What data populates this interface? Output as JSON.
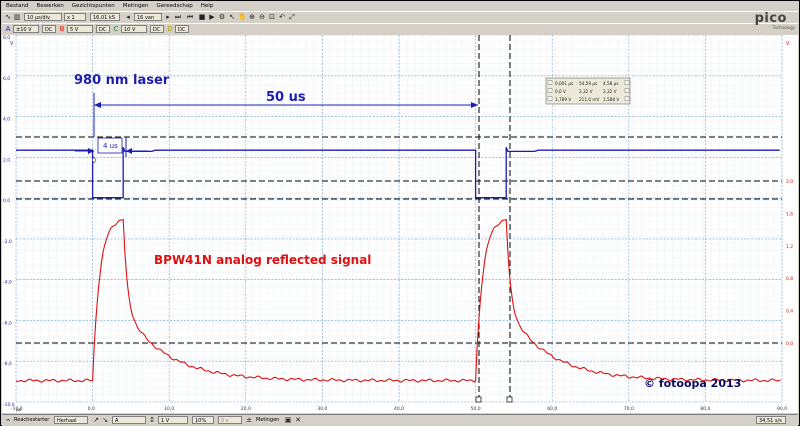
{
  "menu": [
    "Bestand",
    "Bewerken",
    "Gezichtspunten",
    "Metingen",
    "Gereedschap",
    "Help"
  ],
  "toolbar": {
    "timebase": "10 µs/div",
    "zoom": "x 1",
    "samples": "16,01 kS",
    "capture_count": "16 van 16"
  },
  "channels": {
    "a_range": "±10 V",
    "a_coupling": "DC",
    "b_range": "5 V",
    "b_coupling": "DC",
    "c_range": "10 V",
    "c_coupling": "DC",
    "d_coupling": "DC"
  },
  "logo": "pico",
  "logo_sub": "Technology",
  "axes": {
    "left_unit": "V",
    "left_ticks": [
      "8,0",
      "6,0",
      "4,0",
      "2,0",
      "0,0",
      "-2,0",
      "-4,0",
      "-6,0",
      "-8,0",
      "-10,0"
    ],
    "right_unit": "V",
    "right_ticks": [
      "2,0",
      "1,6",
      "1,2",
      "0,8",
      "0,4",
      "0,0"
    ],
    "x_ticks": [
      "-10,0",
      "0,0",
      "10,0",
      "20,0",
      "30,0",
      "40,0",
      "50,0",
      "60,0",
      "70,0",
      "80,0",
      "90,0"
    ],
    "x_unit": "µs"
  },
  "annotations": {
    "laser": "980 nm laser",
    "period": "50 us",
    "pulse": "4 us",
    "signal": "BPW41N analog reflected signal",
    "copyright": "© fotoopa 2013"
  },
  "ruler_table": {
    "rows": [
      [
        "0,001 µs",
        "54,59 µs",
        "4,58 µs"
      ],
      [
        "0,0 V",
        "2,32 V",
        "2,32 V"
      ],
      [
        "1,789 V",
        "211,0 mV",
        "1,588 V"
      ]
    ]
  },
  "status": {
    "trigger_label": "Reactiestarter",
    "trigger_mode": "Herhaal",
    "trigger_source": "A",
    "trigger_level": "1 V",
    "percent": "10%",
    "time": "0 s",
    "measurements_label": "Metingen",
    "zoom_readout": "34,51 s/s"
  },
  "colors": {
    "channel_a": "#1c1cb4",
    "channel_b": "#e01010",
    "grid": "#6fa0c8",
    "ruler": "#000000"
  }
}
